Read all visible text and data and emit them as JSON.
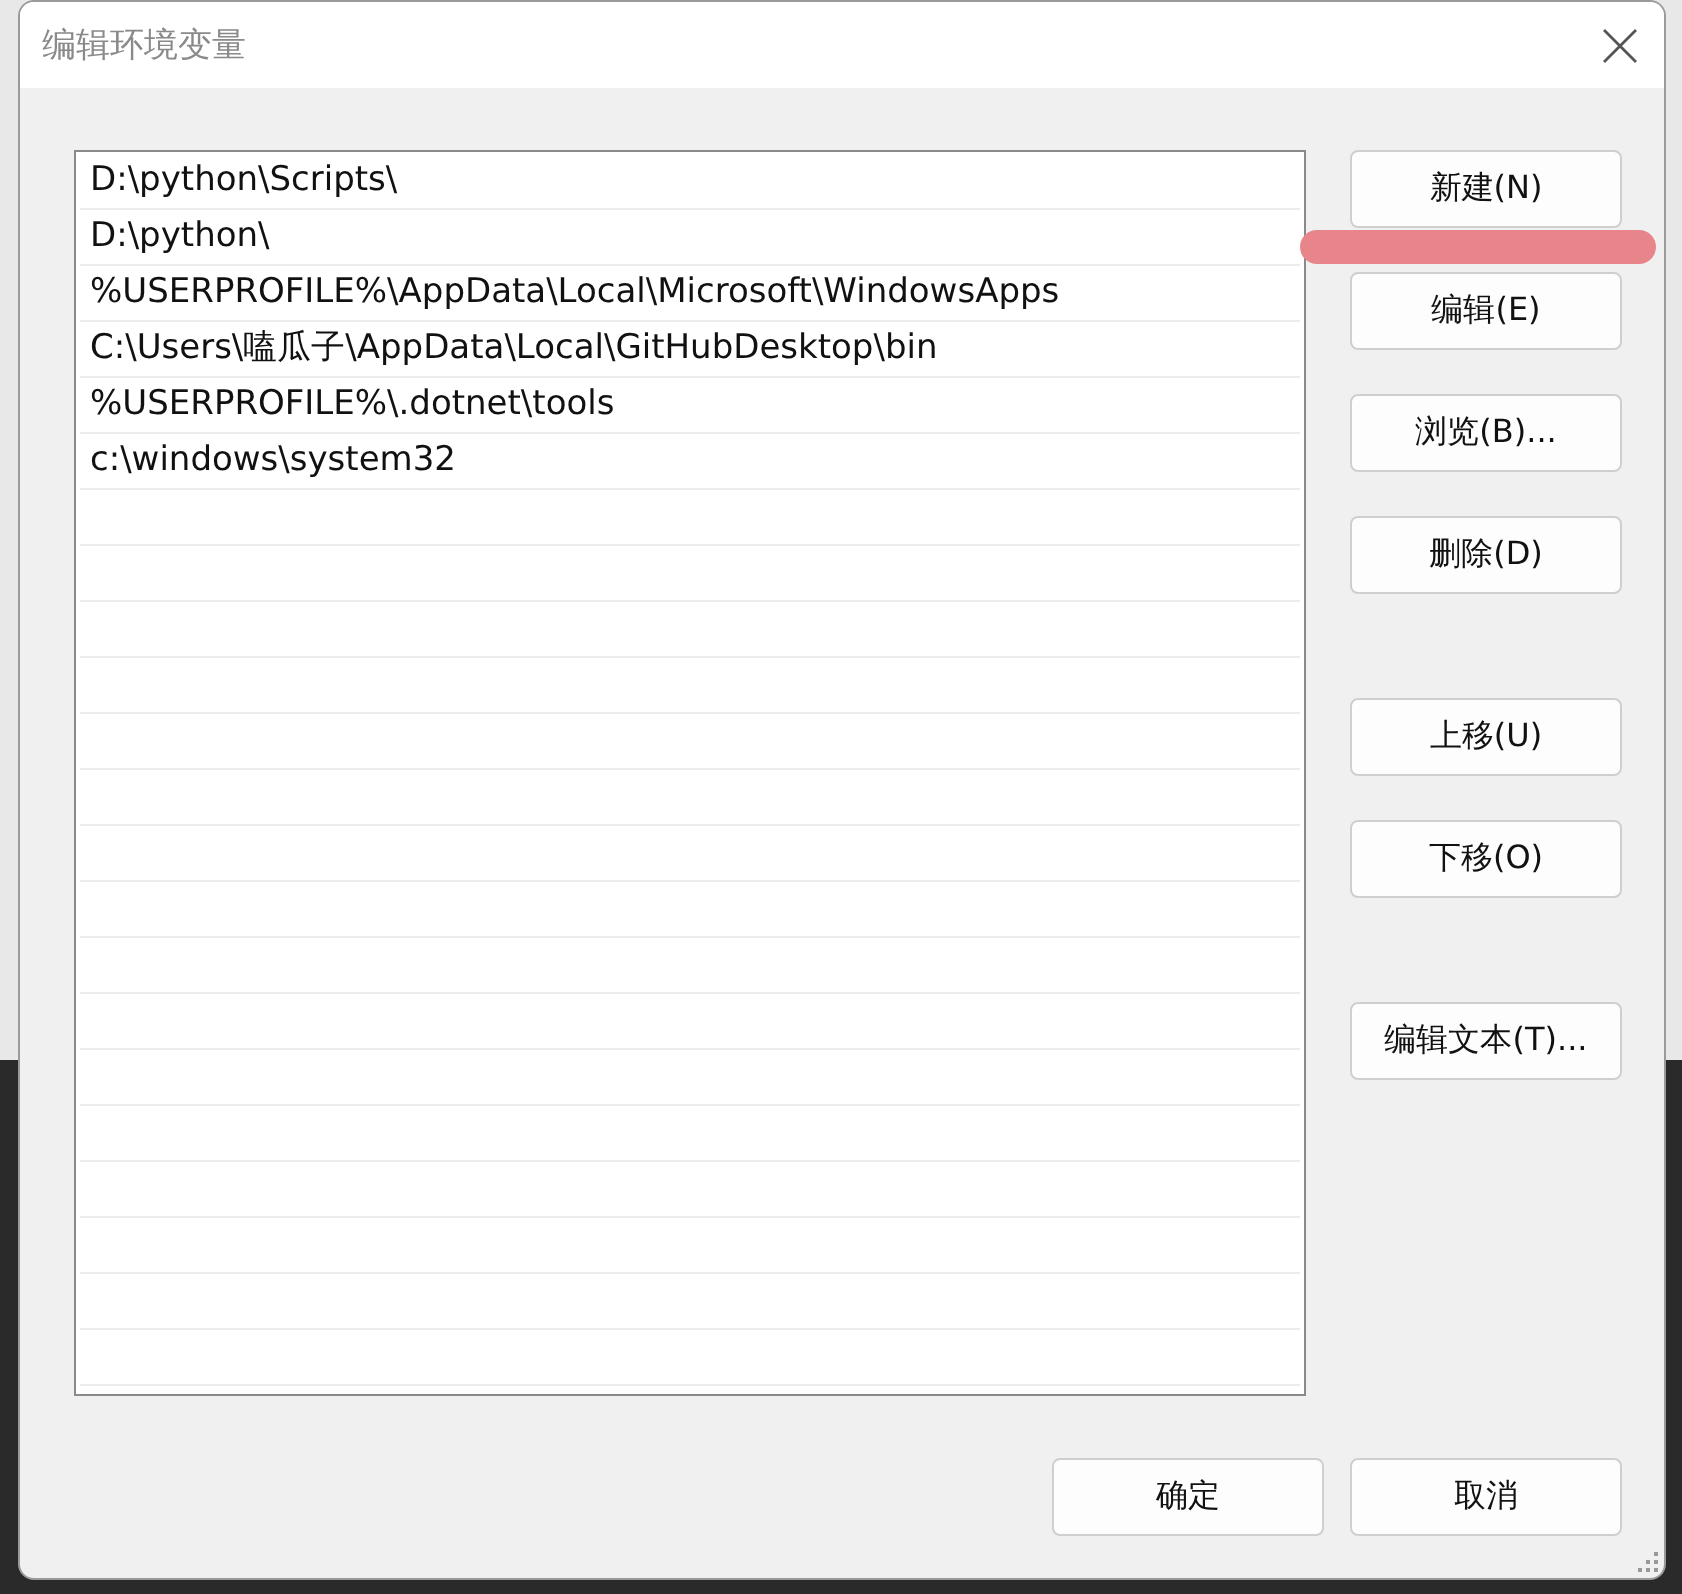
{
  "window": {
    "title": "编辑环境变量"
  },
  "entries": [
    "D:\\python\\Scripts\\",
    "D:\\python\\",
    "%USERPROFILE%\\AppData\\Local\\Microsoft\\WindowsApps",
    "C:\\Users\\嗑瓜子\\AppData\\Local\\GitHubDesktop\\bin",
    "%USERPROFILE%\\.dotnet\\tools",
    "c:\\windows\\system32"
  ],
  "side_button_groups": [
    [
      "新建(N)",
      "编辑(E)",
      "浏览(B)...",
      "删除(D)"
    ],
    [
      "上移(U)",
      "下移(O)"
    ],
    [
      "编辑文本(T)..."
    ]
  ],
  "footer_buttons": [
    "确定",
    "取消"
  ]
}
